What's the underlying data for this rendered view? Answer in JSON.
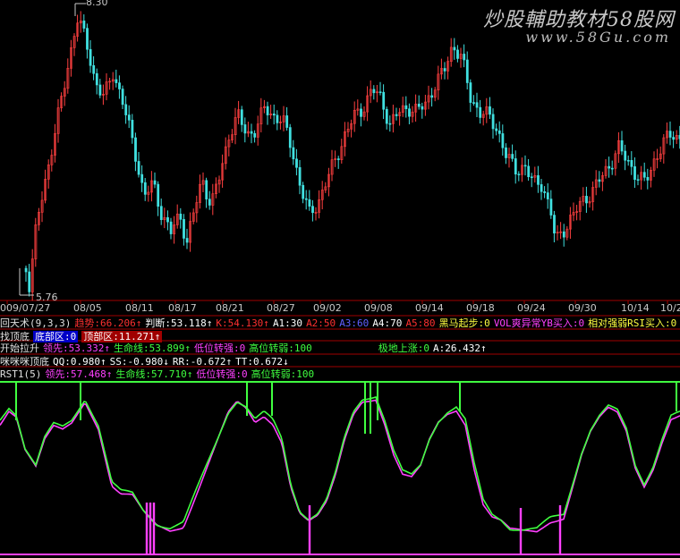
{
  "watermark": {
    "title": "炒股輔助教材58股网",
    "url": "www.58Gu.com"
  },
  "price_labels": {
    "high": "8.30",
    "low": "5.76"
  },
  "dates": [
    "009/07/27",
    "08/05",
    "08/11",
    "08/17",
    "08/21",
    "08/27",
    "09/02",
    "09/08",
    "09/14",
    "09/18",
    "09/24",
    "09/30",
    "10/14",
    "10/2"
  ],
  "rows": {
    "r1": [
      {
        "t": "回天术(9,3,3)",
        "c": "#e0e0e0"
      },
      {
        "t": "趋势:66.206↑",
        "c": "#ff3030"
      },
      {
        "t": "判断:53.118↑",
        "c": "#ffffff"
      },
      {
        "t": "K:54.130↑",
        "c": "#ff3030"
      },
      {
        "t": "A1:30",
        "c": "#ffffff"
      },
      {
        "t": "A2:50",
        "c": "#ff3030"
      },
      {
        "t": "A3:60",
        "c": "#6060ff"
      },
      {
        "t": "A4:70",
        "c": "#ffffff"
      },
      {
        "t": "A5:80",
        "c": "#ff3030"
      },
      {
        "t": "黑马起步:0",
        "c": "#ffff40"
      },
      {
        "t": "VOL爽异常YB买入:0",
        "c": "#ff40ff"
      },
      {
        "t": "相对强弱RSI买入:0",
        "c": "#ffff40"
      }
    ],
    "r2": [
      {
        "t": "找顶底",
        "c": "#e0e0e0"
      },
      {
        "t": "底部区:0",
        "c": "#ffffff",
        "cls": "hl"
      },
      {
        "t": "顶部区:11.271↑",
        "c": "#ffffff",
        "cls": "hlr"
      }
    ],
    "r3": [
      {
        "t": "开始拉升",
        "c": "#e0e0e0"
      },
      {
        "t": "领先:53.332↑",
        "c": "#ff40ff"
      },
      {
        "t": "生命线:53.899↑",
        "c": "#40ff40"
      },
      {
        "t": "低位转强:0",
        "c": "#ff40ff"
      },
      {
        "t": "高位转弱:100",
        "c": "#40ff40"
      },
      {
        "t": "极地上涨:0",
        "c": "#40ff40"
      },
      {
        "t": "A:26.432↑",
        "c": "#ffffff"
      }
    ],
    "r4": [
      {
        "t": "咪咪咪顶底",
        "c": "#e0e0e0"
      },
      {
        "t": "QQ:0.980↑",
        "c": "#ffffff"
      },
      {
        "t": "SS:-0.980↓",
        "c": "#ffffff"
      },
      {
        "t": "RR:-0.672↑",
        "c": "#ffffff"
      },
      {
        "t": "TT:0.672↓",
        "c": "#ffffff"
      }
    ],
    "r5": [
      {
        "t": "RST1(5)",
        "c": "#e0e0e0"
      },
      {
        "t": "领先:57.468↑",
        "c": "#ff40ff"
      },
      {
        "t": "生命线:57.710↑",
        "c": "#40ff40"
      },
      {
        "t": "低位转强:0",
        "c": "#ff40ff"
      },
      {
        "t": "高位转弱:100",
        "c": "#40ff40"
      }
    ]
  },
  "colors": {
    "up": "#ff4040",
    "down": "#40e0e0",
    "green": "#40ff40",
    "magenta": "#ff40ff",
    "border": "#a00000"
  }
}
